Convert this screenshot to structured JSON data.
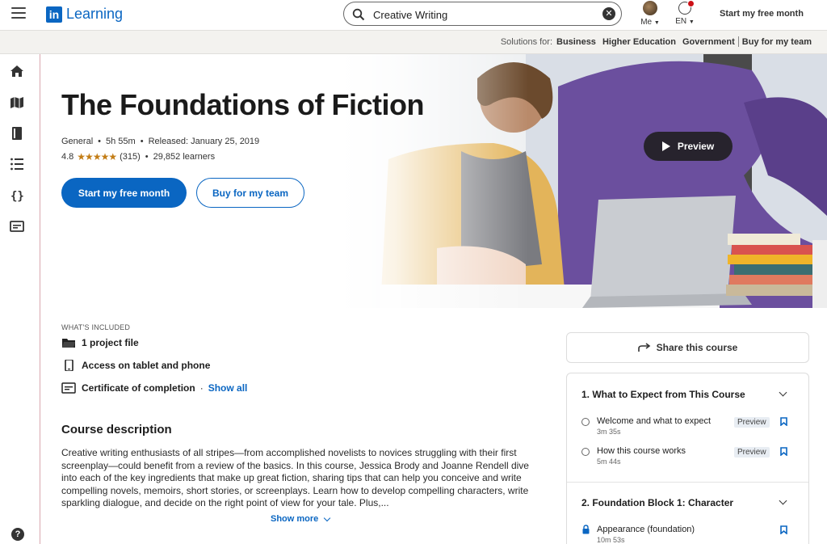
{
  "nav": {
    "logo_letters": "in",
    "brand": "Learning",
    "search_value": "Creative Writing",
    "clear_symbol": "✕",
    "me_label": "Me",
    "lang_label": "EN",
    "cta": "Start my free month"
  },
  "solutions": {
    "prefix": "Solutions for:",
    "items": [
      "Business",
      "Higher Education",
      "Government",
      "Buy for my team"
    ]
  },
  "sidebar": {
    "icons": [
      "home-icon",
      "map-icon",
      "book-icon",
      "list-icon",
      "code-icon",
      "certificate-icon"
    ],
    "help_symbol": "?"
  },
  "hero": {
    "title": "The Foundations of Fiction",
    "level": "General",
    "duration": "5h 55m",
    "released": "Released: January 25, 2019",
    "rating": "4.8",
    "stars": "★★★★★",
    "reviews": "(315)",
    "learners": "29,852 learners",
    "primary_button": "Start my free month",
    "secondary_button": "Buy for my team",
    "preview_button": "Preview"
  },
  "included": {
    "label": "WHAT'S INCLUDED",
    "items": [
      "1 project file",
      "Access on tablet and phone",
      "Certificate of completion"
    ],
    "show_all": "Show all"
  },
  "description": {
    "title": "Course description",
    "text": "Creative writing enthusiasts of all stripes—from accomplished novelists to novices struggling with their first screenplay—could benefit from a review of the basics. In this course, Jessica Brody and Joanne Rendell dive into each of the key ingredients that make up great fiction, sharing tips that can help you conceive and write compelling novels, memoirs, short stories, or screenplays. Learn how to develop compelling characters, write sparkling dialogue, and decide on the right point of view for your tale. Plus,...",
    "show_more": "Show more"
  },
  "share": {
    "label": "Share this course"
  },
  "toc": {
    "chapters": [
      {
        "title": "1. What to Expect from This Course",
        "lessons": [
          {
            "name": "Welcome and what to expect",
            "duration": "3m 35s",
            "tag": "Preview"
          },
          {
            "name": "How this course works",
            "duration": "5m 44s",
            "tag": "Preview"
          }
        ]
      },
      {
        "title": "2. Foundation Block 1: Character",
        "lessons": [
          {
            "name": "Appearance (foundation)",
            "duration": "10m 53s"
          }
        ]
      }
    ]
  },
  "colors": {
    "brand_blue": "#0a66c2",
    "star_gold": "#c37d16",
    "hero_purple": "#6b4f9e"
  }
}
